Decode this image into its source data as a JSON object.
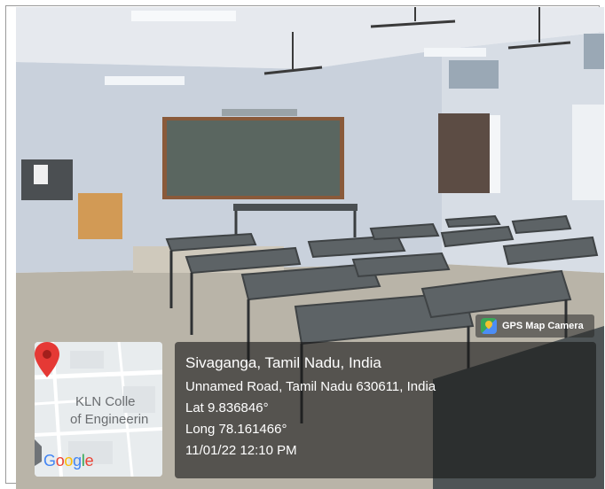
{
  "overlay": {
    "badge_text": "GPS Map Camera",
    "location_title": "Sivaganga, Tamil Nadu, India",
    "address": "Unnamed Road, Tamil Nadu 630611, India",
    "latitude": "Lat 9.836846°",
    "longitude": "Long 78.161466°",
    "datetime": "11/01/22 12:10 PM"
  },
  "map": {
    "label_line1": "KLN Colle",
    "label_line2": "of Engineerin",
    "logo_letters": [
      "G",
      "o",
      "o",
      "g",
      "l",
      "e"
    ],
    "logo_colors": [
      "#4285f4",
      "#ea4335",
      "#fbbc05",
      "#4285f4",
      "#34a853",
      "#ea4335"
    ],
    "pin_color": "#e53935"
  },
  "scene": {
    "wall_color": "#c9d1dc",
    "floor_color": "#b9b4a8",
    "board_color": "#5a6660",
    "desk_color": "#5d6366"
  }
}
